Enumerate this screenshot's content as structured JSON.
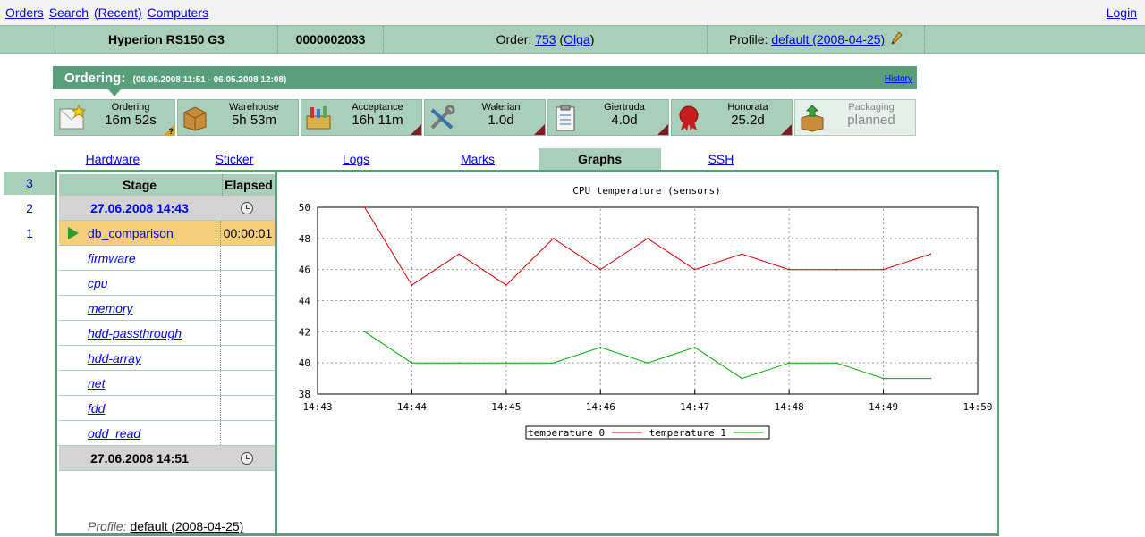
{
  "topnav": {
    "links": [
      "Orders",
      "Search",
      "(Recent)",
      "Computers"
    ],
    "login": "Login"
  },
  "infobar": {
    "model": "Hyperion RS150 G3",
    "serial": "0000002033",
    "order_label": "Order:",
    "order_number": "753",
    "order_person": "Olga",
    "profile_label": "Profile:",
    "profile_value": "default (2008-04-25)",
    "edit_icon": "pencil-icon"
  },
  "ordering": {
    "title": "Ordering:",
    "range": "(06.05.2008 11:51 - 06.05.2008 12:08)",
    "history": "History"
  },
  "stages": [
    {
      "name": "Ordering",
      "value": "16m 52s",
      "icon": "ordering-icon",
      "badge": "?"
    },
    {
      "name": "Warehouse",
      "value": "5h 53m",
      "icon": "box-icon",
      "badge": ""
    },
    {
      "name": "Acceptance",
      "value": "16h 11m",
      "icon": "toolbox-icon",
      "badge": ""
    },
    {
      "name": "Walerian",
      "value": "1.0d",
      "icon": "tools-icon",
      "badge": ""
    },
    {
      "name": "Giertruda",
      "value": "4.0d",
      "icon": "clipboard-icon",
      "badge": ""
    },
    {
      "name": "Honorata",
      "value": "25.2d",
      "icon": "seal-icon",
      "badge": ""
    },
    {
      "name": "Packaging",
      "value": "planned",
      "icon": "packaging-icon",
      "badge": ""
    }
  ],
  "tabs": [
    "Hardware",
    "Sticker",
    "Logs",
    "Marks",
    "Graphs",
    "SSH"
  ],
  "active_tab": "Graphs",
  "runs": [
    "3",
    "2",
    "1"
  ],
  "stage_table": {
    "col_stage": "Stage",
    "col_elapsed": "Elapsed",
    "start_time": "27.06.2008 14:43",
    "current": {
      "name": "db_comparison",
      "elapsed": "00:00:01"
    },
    "items": [
      "firmware",
      "cpu",
      "memory",
      "hdd-passthrough",
      "hdd-array",
      "net",
      "fdd",
      "odd_read"
    ],
    "end_time": "27.06.2008 14:51"
  },
  "profile_footer": {
    "label": "Profile:",
    "value": "default (2008-04-25)"
  },
  "chart_data": {
    "type": "line",
    "title": "CPU temperature (sensors)",
    "xlabel": "",
    "ylabel": "",
    "x_ticks": [
      "14:43",
      "14:44",
      "14:45",
      "14:46",
      "14:47",
      "14:48",
      "14:49",
      "14:50"
    ],
    "y_ticks": [
      38,
      40,
      42,
      44,
      46,
      48,
      50
    ],
    "xlim": [
      "14:43",
      "14:50"
    ],
    "ylim": [
      38,
      50
    ],
    "grid": true,
    "legend": "bottom-center",
    "series": [
      {
        "name": "temperature 0",
        "color": "#cc0000",
        "x": [
          "14:43:30",
          "14:44:00",
          "14:44:30",
          "14:45:00",
          "14:45:30",
          "14:46:00",
          "14:46:30",
          "14:47:00",
          "14:47:30",
          "14:48:00",
          "14:48:30",
          "14:49:00",
          "14:49:30"
        ],
        "values": [
          50,
          45,
          47,
          45,
          48,
          46,
          48,
          46,
          47,
          46,
          46,
          46,
          47
        ]
      },
      {
        "name": "temperature 1",
        "color": "#00aa00",
        "x": [
          "14:43:30",
          "14:44:00",
          "14:44:30",
          "14:45:00",
          "14:45:30",
          "14:46:00",
          "14:46:30",
          "14:47:00",
          "14:47:30",
          "14:48:00",
          "14:48:30",
          "14:49:00",
          "14:49:30"
        ],
        "values": [
          42,
          40,
          40,
          40,
          40,
          41,
          40,
          41,
          39,
          40,
          40,
          39,
          39
        ]
      }
    ]
  }
}
